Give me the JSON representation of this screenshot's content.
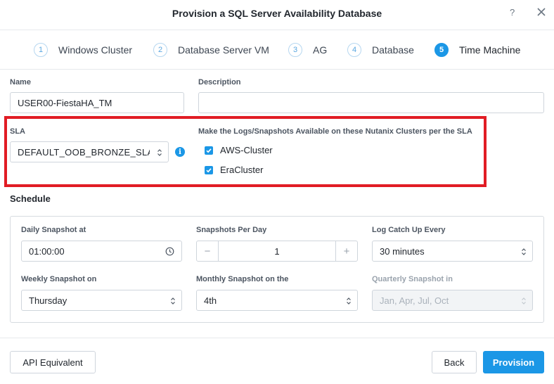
{
  "header": {
    "title": "Provision a SQL Server Availability Database",
    "help": "?"
  },
  "steps": [
    {
      "num": "1",
      "label": "Windows Cluster"
    },
    {
      "num": "2",
      "label": "Database Server VM"
    },
    {
      "num": "3",
      "label": "AG"
    },
    {
      "num": "4",
      "label": "Database"
    },
    {
      "num": "5",
      "label": "Time Machine"
    }
  ],
  "form": {
    "name_label": "Name",
    "name_value": "USER00-FiestaHA_TM",
    "description_label": "Description",
    "description_value": "",
    "sla_label": "SLA",
    "sla_value": "DEFAULT_OOB_BRONZE_SLA",
    "clusters_label": "Make the Logs/Snapshots Available on these Nutanix Clusters per the SLA",
    "clusters": [
      {
        "label": "AWS-Cluster",
        "checked": true
      },
      {
        "label": "EraCluster",
        "checked": true
      }
    ]
  },
  "schedule": {
    "title": "Schedule",
    "daily_label": "Daily Snapshot at",
    "daily_value": "01:00:00",
    "per_day_label": "Snapshots Per Day",
    "per_day_minus": "−",
    "per_day_value": "1",
    "per_day_plus": "+",
    "log_label": "Log Catch Up Every",
    "log_value": "30 minutes",
    "weekly_label": "Weekly Snapshot on",
    "weekly_value": "Thursday",
    "monthly_label": "Monthly Snapshot on the",
    "monthly_value": "4th",
    "quarterly_label": "Quarterly Snapshot in",
    "quarterly_value": "Jan, Apr, Jul, Oct"
  },
  "footer": {
    "api_label": "API Equivalent",
    "back_label": "Back",
    "provision_label": "Provision"
  },
  "colors": {
    "accent": "#1b97e6",
    "highlight": "#e11c24"
  }
}
